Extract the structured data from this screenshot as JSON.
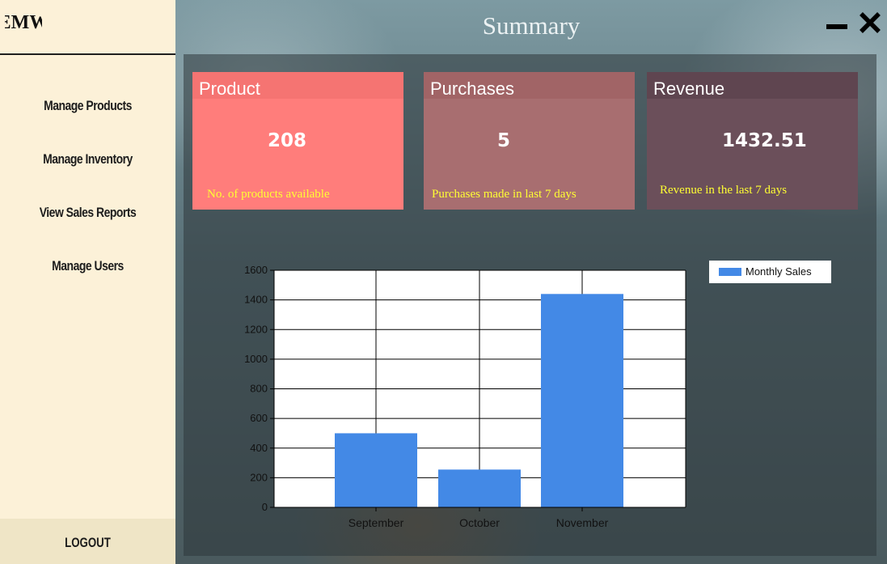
{
  "app": {
    "logo_text": "EMW",
    "title": "Summary"
  },
  "sidebar": {
    "items": [
      {
        "label": "Manage Products"
      },
      {
        "label": "Manage Inventory"
      },
      {
        "label": "View Sales Reports"
      },
      {
        "label": "Manage Users"
      }
    ],
    "logout_label": "LOGOUT"
  },
  "cards": {
    "product": {
      "title": "Product",
      "value": "208",
      "caption": "No. of products available",
      "color": "#ff7d7b",
      "head_color": "#f57472"
    },
    "purchases": {
      "title": "Purchases",
      "value": "5",
      "caption": "Purchases made in last 7 days",
      "color": "#a86e70",
      "head_color": "#a16466"
    },
    "revenue": {
      "title": "Revenue",
      "value": "1432.51",
      "caption": "Revenue in the last 7 days",
      "color": "#6b4f5a",
      "head_color": "#5f4550"
    }
  },
  "chart_data": {
    "type": "bar",
    "categories": [
      "September",
      "October",
      "November"
    ],
    "series": [
      {
        "name": "Monthly Sales",
        "values": [
          500,
          255,
          1440
        ],
        "color": "#4389e6"
      }
    ],
    "ylim": [
      0,
      1600
    ],
    "yticks": [
      0,
      200,
      400,
      600,
      800,
      1000,
      1200,
      1400,
      1600
    ],
    "grid": true,
    "legend": "top-right"
  }
}
